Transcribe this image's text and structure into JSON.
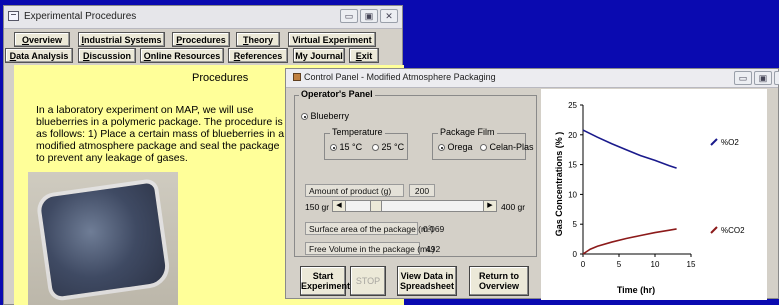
{
  "main_window": {
    "title": "Experimental Procedures",
    "nav_row1": [
      {
        "first": "O",
        "rest": "verview"
      },
      {
        "first": "I",
        "rest": "ndustrial Systems"
      },
      {
        "first": "P",
        "rest": "rocedures"
      },
      {
        "first": "T",
        "rest": "heory"
      },
      {
        "first": "",
        "rest": "Virtual Experiment"
      }
    ],
    "nav_row2": [
      {
        "first": "D",
        "rest": "ata Analysis"
      },
      {
        "first": "D",
        "rest": "iscussion"
      },
      {
        "first": "O",
        "rest": "nline Resources"
      },
      {
        "first": "R",
        "rest": "eferences"
      },
      {
        "first": "",
        "rest": "My Journal"
      },
      {
        "first": "E",
        "rest": "xit"
      }
    ],
    "heading": "Procedures",
    "intro_text": "In a laboratory experiment on MAP, we will use blueberries in a polymeric package. The procedure is as follows:  1) Place a certain mass of blueberries in a modified atmosphere package and seal the package to prevent any leakage of gases."
  },
  "control_panel": {
    "title": "Control Panel - Modified Atmosphere Packaging",
    "operators_panel": "Operator's Panel",
    "fruit_option": "Blueberry",
    "temperature": {
      "label": "Temperature",
      "options": [
        "15 °C",
        "25 °C"
      ],
      "selected": "15 °C"
    },
    "package_film": {
      "label": "Package Film",
      "options": [
        "Orega",
        "Celan-Plas"
      ],
      "selected": "Orega"
    },
    "amount_label": "Amount of product (g)",
    "amount_value": "200",
    "slider": {
      "min_label": "150 gr",
      "max_label": "400 gr",
      "fraction": 0.2
    },
    "surface_label": "Surface area of the package (m²)",
    "surface_value": "0.069",
    "volume_label": "Free Volume in the package (mL)",
    "volume_value": "492",
    "buttons": {
      "start": "Start Experiment",
      "stop": "STOP",
      "view": "View Data in Spreadsheet",
      "return": "Return to Overview"
    }
  },
  "chart_data": {
    "type": "line",
    "xlabel": "Time (hr)",
    "ylabel": "Gas Concentrations (% )",
    "xlim": [
      0,
      15
    ],
    "ylim": [
      0,
      25
    ],
    "x_ticks": [
      "0",
      "5",
      "10",
      "15"
    ],
    "y_ticks": [
      "0",
      "5",
      "10",
      "15",
      "20",
      "25"
    ],
    "series": [
      {
        "name": "%O2",
        "color": "#1a1a8c",
        "x": [
          0,
          2,
          4,
          6,
          8,
          10,
          12,
          13
        ],
        "y": [
          20.8,
          19.6,
          18.5,
          17.5,
          16.5,
          15.7,
          14.8,
          14.4
        ]
      },
      {
        "name": "%CO2",
        "color": "#8c1a1a",
        "x": [
          0,
          1,
          2,
          4,
          6,
          8,
          10,
          12,
          13
        ],
        "y": [
          0,
          0.8,
          1.3,
          2.0,
          2.6,
          3.1,
          3.6,
          4.0,
          4.2
        ]
      }
    ]
  }
}
